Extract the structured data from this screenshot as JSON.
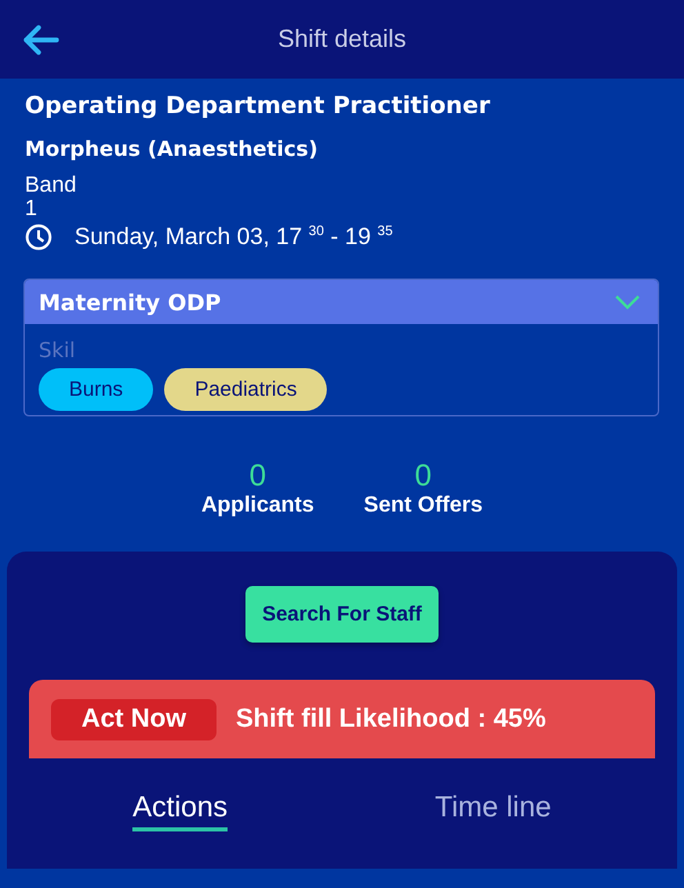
{
  "header": {
    "title": "Shift details"
  },
  "shift": {
    "role": "Operating Department Practitioner",
    "department": "Morpheus (Anaesthetics)",
    "band_label": "Band",
    "band_value": "1",
    "time": "Sunday, March 03, 17 $^{30}$ - 19 $^{35}$"
  },
  "skills_card": {
    "title": "Maternity ODP",
    "expanded": true,
    "placeholder": "Skil",
    "chips": [
      {
        "label": "Burns",
        "color": "#00bff9"
      },
      {
        "label": "Paediatrics",
        "color": "#e3d78a"
      }
    ]
  },
  "stats": [
    {
      "value": "0",
      "label": "Applicants"
    },
    {
      "value": "0",
      "label": "Sent Offers"
    }
  ],
  "search_button": "Search For Staff",
  "alert": {
    "badge": "Act Now",
    "text": "Shift fill Likelihood : 45%"
  },
  "tabs": [
    {
      "label": "Actions",
      "selected": true
    },
    {
      "label": "Time line",
      "selected": false
    }
  ]
}
